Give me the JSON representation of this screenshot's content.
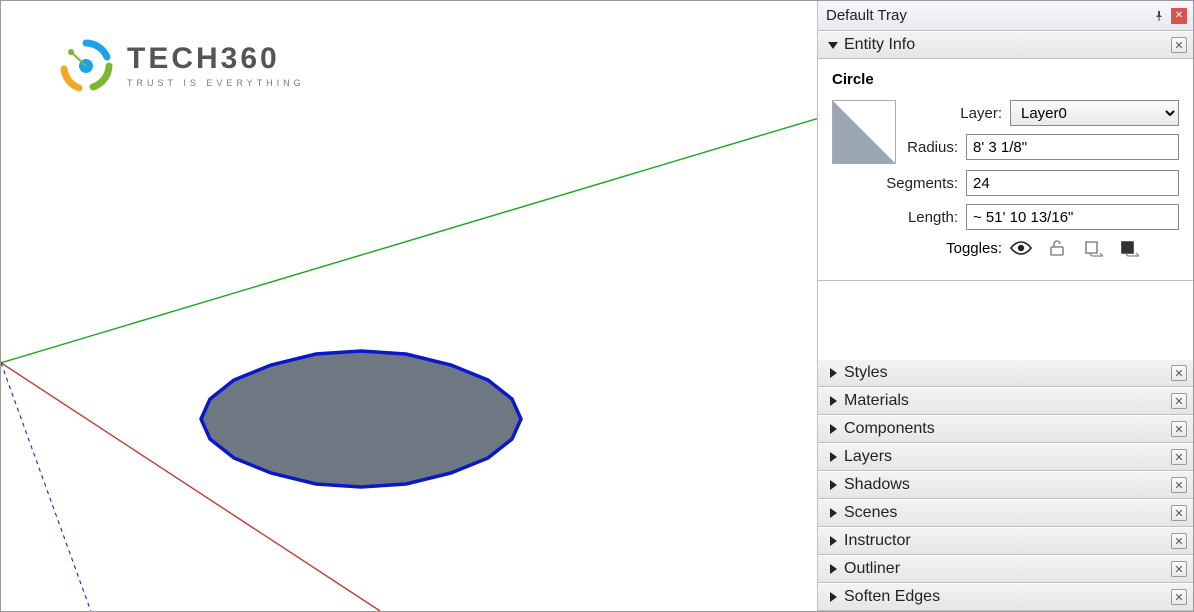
{
  "logo": {
    "brand": "TECH360",
    "tagline": "TRUST IS EVERYTHING"
  },
  "tray": {
    "title": "Default Tray",
    "entity_info": {
      "header": "Entity Info",
      "type": "Circle",
      "fields": {
        "layer_label": "Layer:",
        "layer_value": "Layer0",
        "radius_label": "Radius:",
        "radius_value": "8' 3 1/8\"",
        "segments_label": "Segments:",
        "segments_value": "24",
        "length_label": "Length:",
        "length_value": "~ 51' 10 13/16\"",
        "toggles_label": "Toggles:"
      }
    },
    "panels": [
      {
        "label": "Styles"
      },
      {
        "label": "Materials"
      },
      {
        "label": "Components"
      },
      {
        "label": "Layers"
      },
      {
        "label": "Shadows"
      },
      {
        "label": "Scenes"
      },
      {
        "label": "Instructor"
      },
      {
        "label": "Outliner"
      },
      {
        "label": "Soften Edges"
      }
    ]
  }
}
